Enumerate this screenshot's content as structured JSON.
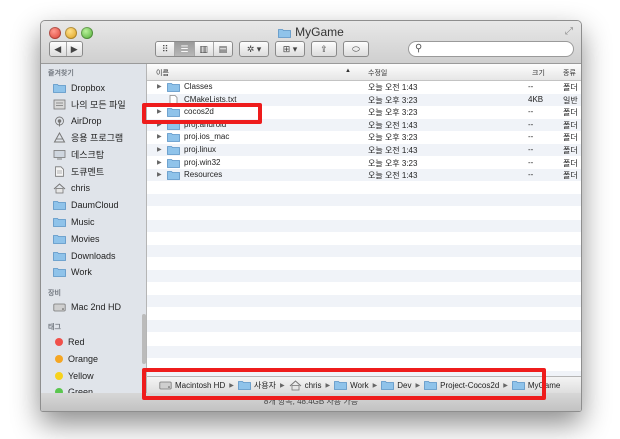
{
  "window": {
    "title": "MyGame"
  },
  "toolbar": {
    "back_label": "◀",
    "forward_label": "▶",
    "views": [
      "⠿",
      "☰",
      "▥",
      "▤"
    ],
    "action_label": "✲ ▾",
    "arrange_label": "⊞ ▾",
    "share_label": "⇪",
    "tag_label": "⬭",
    "search_placeholder": ""
  },
  "sidebar": {
    "favorites_header": "즐겨찾기",
    "favorites": [
      {
        "label": "Dropbox",
        "icon": "folder-icon"
      },
      {
        "label": "나의 모든 파일",
        "icon": "all-files-icon"
      },
      {
        "label": "AirDrop",
        "icon": "airdrop-icon"
      },
      {
        "label": "응용 프로그램",
        "icon": "applications-icon"
      },
      {
        "label": "데스크탑",
        "icon": "desktop-icon"
      },
      {
        "label": "도큐멘트",
        "icon": "documents-icon"
      },
      {
        "label": "chris",
        "icon": "home-icon"
      },
      {
        "label": "DaumCloud",
        "icon": "folder-icon"
      },
      {
        "label": "Music",
        "icon": "folder-icon"
      },
      {
        "label": "Movies",
        "icon": "folder-icon"
      },
      {
        "label": "Downloads",
        "icon": "folder-icon"
      },
      {
        "label": "Work",
        "icon": "folder-icon"
      }
    ],
    "devices_header": "장비",
    "devices": [
      {
        "label": "Mac 2nd HD",
        "icon": "hard-drive-icon"
      }
    ],
    "tags_header": "태그",
    "tags": [
      {
        "label": "Red",
        "color": "#f0504a"
      },
      {
        "label": "Orange",
        "color": "#f5a623"
      },
      {
        "label": "Yellow",
        "color": "#f7d21c"
      },
      {
        "label": "Green",
        "color": "#5ac64e"
      }
    ]
  },
  "columns": {
    "name": "이름",
    "sort_indicator": "▲",
    "date": "수정일",
    "size": "크기",
    "kind": "종류"
  },
  "files": [
    {
      "name": "Classes",
      "date": "오늘 오전 1:43",
      "size": "--",
      "kind": "폴더",
      "type": "folder"
    },
    {
      "name": "CMakeLists.txt",
      "date": "오늘 오후 3:23",
      "size": "4KB",
      "kind": "일반",
      "type": "file"
    },
    {
      "name": "cocos2d",
      "date": "오늘 오후 3:23",
      "size": "--",
      "kind": "폴더",
      "type": "folder"
    },
    {
      "name": "proj.android",
      "date": "오늘 오전 1:43",
      "size": "--",
      "kind": "폴더",
      "type": "folder"
    },
    {
      "name": "proj.ios_mac",
      "date": "오늘 오후 3:23",
      "size": "--",
      "kind": "폴더",
      "type": "folder"
    },
    {
      "name": "proj.linux",
      "date": "오늘 오전 1:43",
      "size": "--",
      "kind": "폴더",
      "type": "folder"
    },
    {
      "name": "proj.win32",
      "date": "오늘 오후 3:23",
      "size": "--",
      "kind": "폴더",
      "type": "folder"
    },
    {
      "name": "Resources",
      "date": "오늘 오전 1:43",
      "size": "--",
      "kind": "폴더",
      "type": "folder"
    }
  ],
  "path": [
    {
      "label": "Macintosh HD",
      "icon": "hard-drive-icon"
    },
    {
      "label": "사용자",
      "icon": "folder-icon"
    },
    {
      "label": "chris",
      "icon": "home-icon"
    },
    {
      "label": "Work",
      "icon": "folder-icon"
    },
    {
      "label": "Dev",
      "icon": "folder-icon"
    },
    {
      "label": "Project-Cocos2d",
      "icon": "folder-icon"
    },
    {
      "label": "MyGame",
      "icon": "folder-icon"
    }
  ],
  "path_separator": "▶",
  "status": "8개 항목, 48.4GB 사용 가능",
  "highlight_color": "#ee1c1c"
}
